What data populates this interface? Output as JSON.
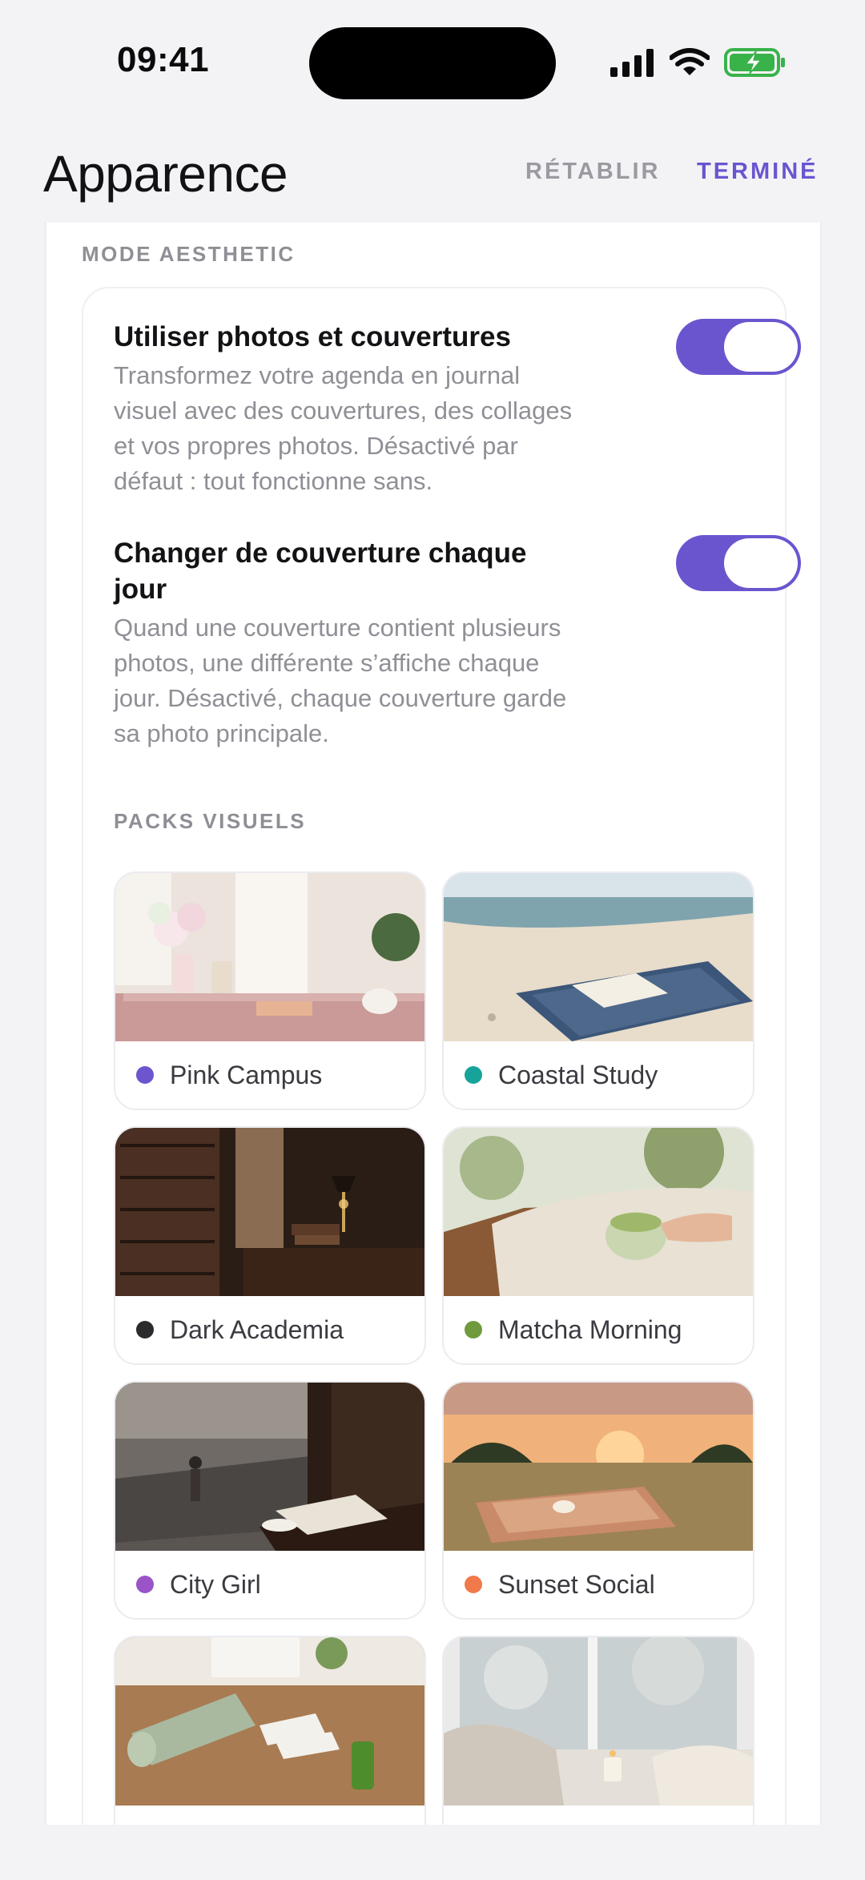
{
  "status_bar": {
    "time": "09:41"
  },
  "header": {
    "title": "Apparence",
    "reset_label": "RÉTABLIR",
    "done_label": "TERMINÉ"
  },
  "aesthetic": {
    "section_label": "MODE AESTHETIC",
    "settings": [
      {
        "title": "Utiliser photos et couvertures",
        "description": "Transformez votre agenda en journal visuel avec des couvertures, des collages et vos propres photos. Désactivé par défaut : tout fonctionne sans.",
        "enabled": true
      },
      {
        "title": "Changer de couverture chaque jour",
        "description": "Quand une couverture contient plusieurs photos, une différente s’affiche chaque jour. Désactivé, chaque couverture garde sa photo principale.",
        "enabled": true
      }
    ],
    "packs_label": "PACKS VISUELS",
    "packs": [
      {
        "name": "Pink Campus",
        "color": "#6d55cf"
      },
      {
        "name": "Coastal Study",
        "color": "#18a39a"
      },
      {
        "name": "Dark Academia",
        "color": "#2b2b2e"
      },
      {
        "name": "Matcha Morning",
        "color": "#6f9a3e"
      },
      {
        "name": "City Girl",
        "color": "#9a54c8"
      },
      {
        "name": "Sunset Social",
        "color": "#f07a4a"
      },
      {
        "name": "",
        "color": ""
      },
      {
        "name": "",
        "color": ""
      }
    ]
  },
  "colors": {
    "accent": "#6b55cf",
    "background": "#f3f3f6"
  }
}
